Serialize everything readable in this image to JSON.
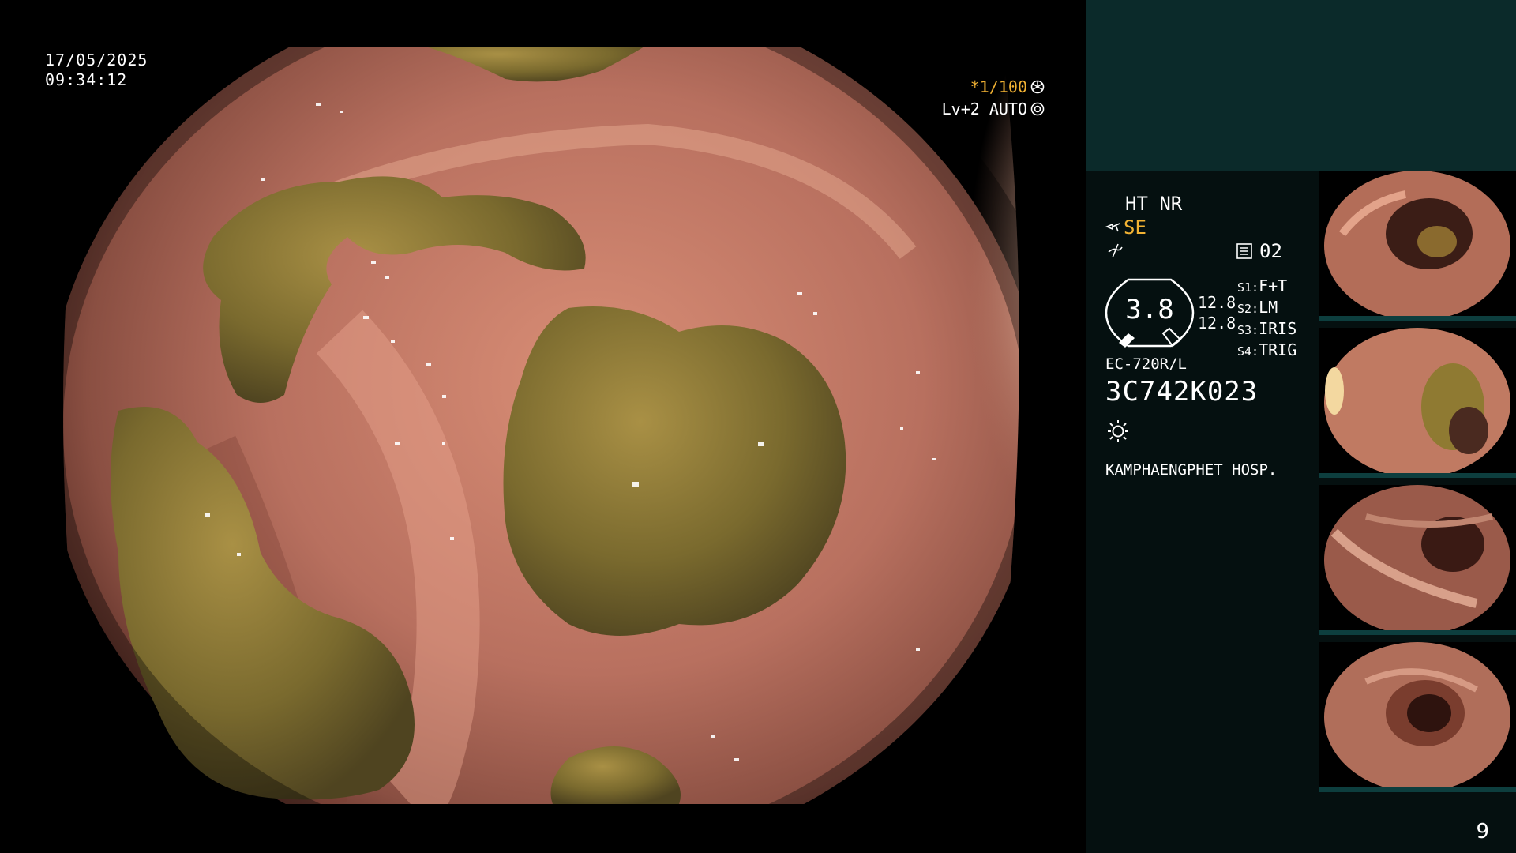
{
  "screen": {
    "date": "17/05/2025",
    "time": "09:34:12",
    "shutter_label": "*1/100",
    "iris_label": "Lv+2 AUTO"
  },
  "panel": {
    "ht_nr": "HT NR",
    "se_label": "SE",
    "mem_value": "02",
    "gauge_value": "3.8",
    "ratio": [
      "12.8",
      "12.8"
    ],
    "switches": [
      {
        "key": "S1:",
        "value": "F+T"
      },
      {
        "key": "S2:",
        "value": "LM"
      },
      {
        "key": "S3:",
        "value": "IRIS"
      },
      {
        "key": "S4:",
        "value": "TRIG"
      }
    ],
    "scope_model": "EC-720R/L",
    "scope_serial": "3C742K023",
    "hospital": "KAMPHAENGPHET HOSP.",
    "page_number": "9"
  },
  "icons": {
    "shutter": "shutter-wheel-icon",
    "iris": "iris-ring-icon",
    "scope_angle": "scope-angle-icon",
    "waveform": "waveform-icon",
    "memory": "memory-card-icon",
    "light": "light-source-icon"
  },
  "colors": {
    "accent": "#f2b233",
    "panel_bg": "#051010",
    "panel_top_bg": "#0b2a2a"
  }
}
